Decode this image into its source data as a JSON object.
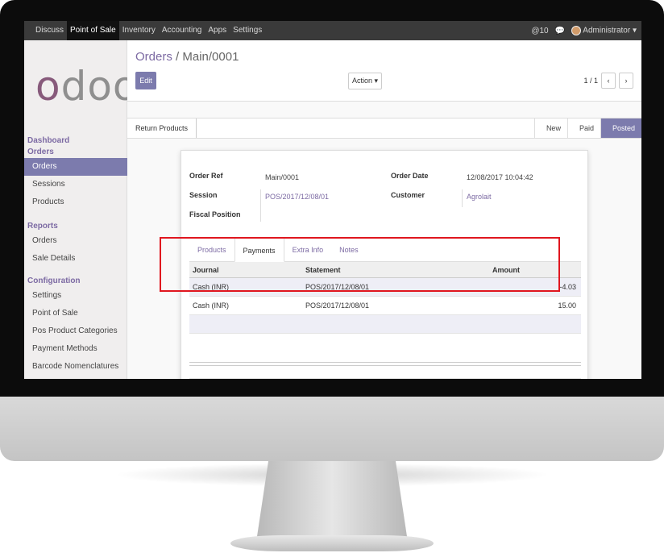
{
  "topbar": {
    "menu": [
      "Discuss",
      "Point of Sale",
      "Inventory",
      "Accounting",
      "Apps",
      "Settings"
    ],
    "active_index": 1,
    "notifications": "10",
    "user": "Administrator"
  },
  "sidebar": {
    "logo": "odoo",
    "sections": [
      {
        "title": "Dashboard",
        "items": []
      },
      {
        "title": "Orders",
        "items": [
          "Orders",
          "Sessions",
          "Products"
        ]
      },
      {
        "title": "Reports",
        "items": [
          "Orders",
          "Sale Details"
        ]
      },
      {
        "title": "Configuration",
        "items": [
          "Settings",
          "Point of Sale",
          "Pos Product Categories",
          "Payment Methods",
          "Barcode Nomenclatures"
        ]
      }
    ]
  },
  "control_panel": {
    "breadcrumb_parent": "Orders",
    "breadcrumb_separator": " / ",
    "breadcrumb_current": "Main/0001",
    "edit_label": "Edit",
    "action_label": "Action ▾",
    "pager": "1 / 1",
    "prev": "‹",
    "next": "›"
  },
  "statusbar": {
    "return_label": "Return Products",
    "stages": [
      "New",
      "Paid",
      "Posted"
    ],
    "current_stage": "Posted"
  },
  "form": {
    "order_ref_label": "Order Ref",
    "order_ref": "Main/0001",
    "session_label": "Session",
    "session": "POS/2017/12/08/01",
    "fiscal_label": "Fiscal Position",
    "order_date_label": "Order Date",
    "order_date": "12/08/2017 10:04:42",
    "customer_label": "Customer",
    "customer": "Agrolait"
  },
  "tabs": [
    "Products",
    "Payments",
    "Extra Info",
    "Notes"
  ],
  "active_tab": "Payments",
  "payments": {
    "columns": [
      "Journal",
      "Statement",
      "Amount"
    ],
    "rows": [
      {
        "journal": "Cash (INR)",
        "statement": "POS/2017/12/08/01",
        "amount": "-4.03"
      },
      {
        "journal": "Cash (INR)",
        "statement": "POS/2017/12/08/01",
        "amount": "15.00"
      }
    ]
  },
  "colors": {
    "brand": "#7c7bad",
    "highlight": "#e0161f"
  }
}
